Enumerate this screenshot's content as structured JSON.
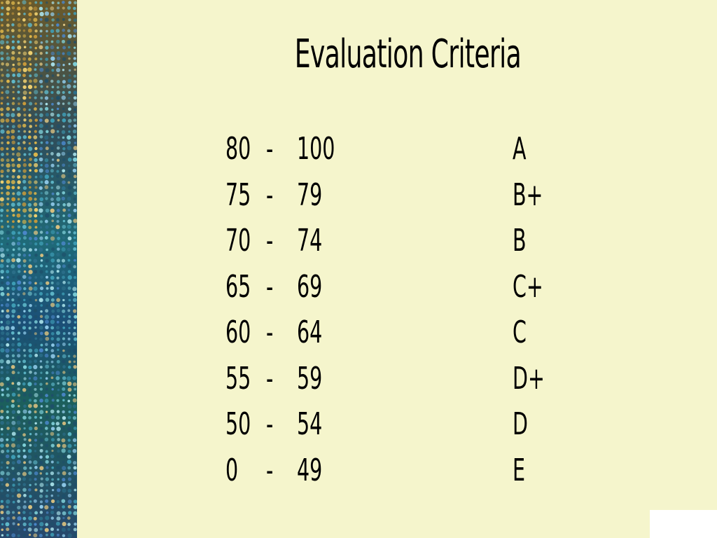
{
  "slide": {
    "title": "Evaluation Criteria",
    "background_color": "#f5f5cc",
    "decor": "sequin-dot-pattern-left-band"
  },
  "grading_scale": [
    {
      "min": "80",
      "dash": "-",
      "max": "100",
      "grade": "A"
    },
    {
      "min": "75",
      "dash": "-",
      "max": "79",
      "grade": "B+"
    },
    {
      "min": "70",
      "dash": "-",
      "max": "74",
      "grade": "B"
    },
    {
      "min": "65",
      "dash": "-",
      "max": "69",
      "grade": "C+"
    },
    {
      "min": "60",
      "dash": "-",
      "max": "64",
      "grade": "C"
    },
    {
      "min": "55",
      "dash": "-",
      "max": "59",
      "grade": "D+"
    },
    {
      "min": "50",
      "dash": "-",
      "max": "54",
      "grade": "D"
    },
    {
      "min": "0",
      "dash": "-",
      "max": "49",
      "grade": "E"
    }
  ]
}
